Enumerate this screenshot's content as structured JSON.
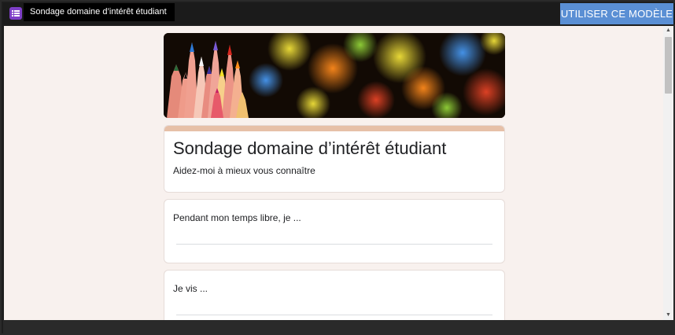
{
  "window": {
    "title": "Sondage domaine d’intérêt étudiant",
    "app_icon": "forms-icon",
    "use_template_label": "UTILISER CE MODÈLE",
    "accent_color": "#5a8fd4",
    "icon_color": "#7e3fc7"
  },
  "form": {
    "banner_image": "colored-pencils-bokeh",
    "title": "Sondage domaine d’intérêt étudiant",
    "description": "Aidez-moi à mieux vous connaître",
    "header_color": "#e6c0a8",
    "background_color": "#f8f1ee",
    "questions": [
      {
        "label": "Pendant mon temps libre, je ..."
      },
      {
        "label": "Je vis ..."
      }
    ]
  }
}
